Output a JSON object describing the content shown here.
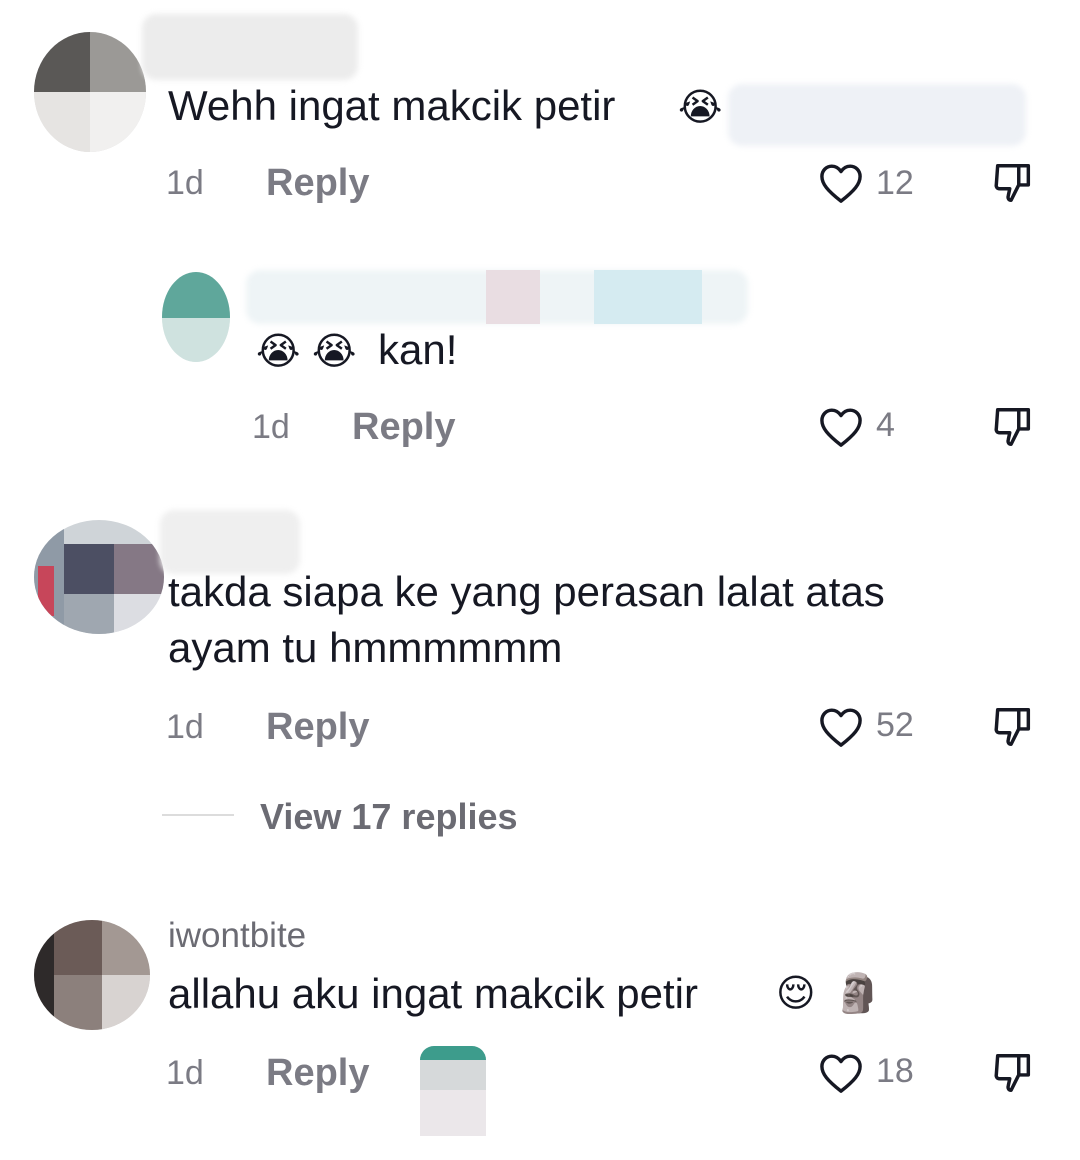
{
  "comments": [
    {
      "username": "",
      "text": "Wehh ingat makcik petir",
      "age": "1d",
      "reply_label": "Reply",
      "likes": "12"
    },
    {
      "username": "",
      "text": "kan!",
      "age": "1d",
      "reply_label": "Reply",
      "likes": "4"
    },
    {
      "username": "",
      "text_line1": "takda siapa ke yang perasan lalat atas",
      "text_line2": "ayam tu hmmmmmm",
      "age": "1d",
      "reply_label": "Reply",
      "likes": "52",
      "view_replies_label": "View 17 replies"
    },
    {
      "username": "iwontbite",
      "text": "allahu aku ingat makcik petir",
      "age": "1d",
      "reply_label": "Reply",
      "likes": "18"
    }
  ],
  "icons": {
    "like": "heart-outline-icon",
    "dislike": "thumbs-down-icon",
    "emoji_crying": "😭",
    "emoji_relieved": "😌",
    "emoji_moai": "🗿"
  },
  "colors": {
    "text": "#161823",
    "muted": "#7b7b84"
  }
}
